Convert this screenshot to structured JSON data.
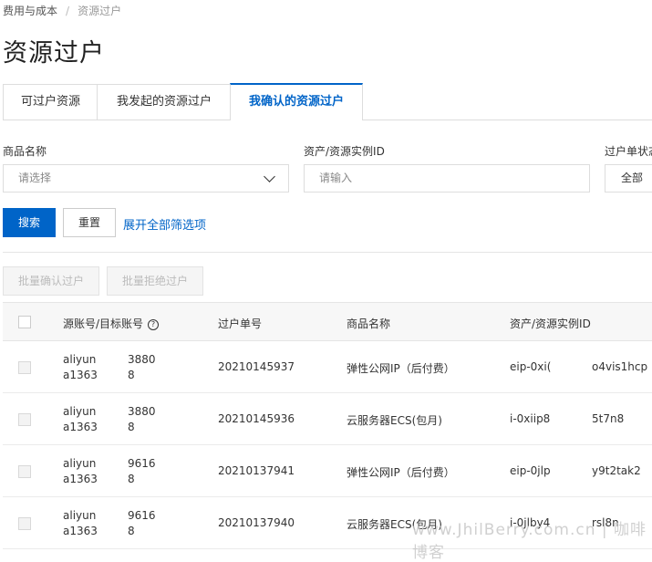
{
  "breadcrumb": {
    "parent": "费用与成本",
    "separator": "/",
    "current": "资源过户"
  },
  "page": {
    "title": "资源过户"
  },
  "tabs": [
    {
      "label": "可过户资源",
      "active": false
    },
    {
      "label": "我发起的资源过户",
      "active": false
    },
    {
      "label": "我确认的资源过户",
      "active": true
    }
  ],
  "filters": {
    "product": {
      "label": "商品名称",
      "placeholder": "请选择"
    },
    "instance": {
      "label": "资产/资源实例ID",
      "placeholder": "请输入"
    },
    "status": {
      "label": "过户单状态",
      "value": "全部"
    }
  },
  "actions": {
    "search": "搜索",
    "reset": "重置",
    "expand": "展开全部筛选项"
  },
  "bulk": {
    "confirm": "批量确认过户",
    "reject": "批量拒绝过户"
  },
  "table": {
    "columns": {
      "account": "源账号/目标账号",
      "order": "过户单号",
      "product": "商品名称",
      "instance": "资产/资源实例ID"
    },
    "help_icon": "?",
    "rows": [
      {
        "acct1a": "aliyun",
        "acct1b": "3880",
        "acct2a": "a1363",
        "acct2b": "8",
        "order": "20210145937",
        "product": "弹性公网IP（后付费）",
        "inst_a": "eip-0xi(",
        "inst_b": "o4vis1hcp"
      },
      {
        "acct1a": "aliyun",
        "acct1b": "3880",
        "acct2a": "a1363",
        "acct2b": "8",
        "order": "20210145936",
        "product": "云服务器ECS(包月)",
        "inst_a": "i-0xiip8",
        "inst_b": "5t7n8"
      },
      {
        "acct1a": "aliyun",
        "acct1b": "9616",
        "acct2a": "a1363",
        "acct2b": "8",
        "order": "20210137941",
        "product": "弹性公网IP（后付费）",
        "inst_a": "eip-0jlp",
        "inst_b": "y9t2tak2"
      },
      {
        "acct1a": "aliyun",
        "acct1b": "9616",
        "acct2a": "a1363",
        "acct2b": "8",
        "order": "20210137940",
        "product": "云服务器ECS(包月)",
        "inst_a": "i-0jlby4",
        "inst_b": "rsl8n"
      }
    ]
  },
  "watermark": "www.JhilBerry.com.cn  |  咖啡博客",
  "colors": {
    "primary": "#0064c8",
    "border": "#dddddd",
    "header_bg": "#f7f7f7"
  }
}
